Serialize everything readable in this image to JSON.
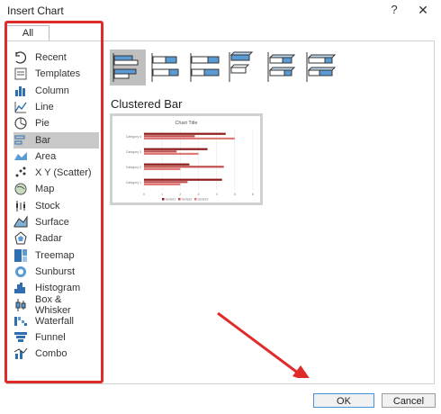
{
  "window": {
    "title": "Insert Chart",
    "help_label": "?",
    "close_label": "✕"
  },
  "tabs": [
    {
      "label": "All Charts"
    }
  ],
  "categories": [
    {
      "label": "Recent",
      "icon": "recent-icon"
    },
    {
      "label": "Templates",
      "icon": "templates-icon"
    },
    {
      "label": "Column",
      "icon": "column-chart-icon"
    },
    {
      "label": "Line",
      "icon": "line-chart-icon"
    },
    {
      "label": "Pie",
      "icon": "pie-chart-icon"
    },
    {
      "label": "Bar",
      "icon": "bar-chart-icon",
      "selected": true
    },
    {
      "label": "Area",
      "icon": "area-chart-icon"
    },
    {
      "label": "X Y (Scatter)",
      "icon": "scatter-chart-icon"
    },
    {
      "label": "Map",
      "icon": "map-chart-icon"
    },
    {
      "label": "Stock",
      "icon": "stock-chart-icon"
    },
    {
      "label": "Surface",
      "icon": "surface-chart-icon"
    },
    {
      "label": "Radar",
      "icon": "radar-chart-icon"
    },
    {
      "label": "Treemap",
      "icon": "treemap-chart-icon"
    },
    {
      "label": "Sunburst",
      "icon": "sunburst-chart-icon"
    },
    {
      "label": "Histogram",
      "icon": "histogram-chart-icon"
    },
    {
      "label": "Box & Whisker",
      "icon": "box-whisker-chart-icon"
    },
    {
      "label": "Waterfall",
      "icon": "waterfall-chart-icon"
    },
    {
      "label": "Funnel",
      "icon": "funnel-chart-icon"
    },
    {
      "label": "Combo",
      "icon": "combo-chart-icon"
    }
  ],
  "subtypes": [
    {
      "icon": "clustered-bar-icon",
      "active": true
    },
    {
      "icon": "stacked-bar-icon"
    },
    {
      "icon": "100-stacked-bar-icon"
    },
    {
      "icon": "3d-clustered-bar-icon"
    },
    {
      "icon": "3d-stacked-bar-icon"
    },
    {
      "icon": "3d-100-stacked-bar-icon"
    }
  ],
  "preview": {
    "heading": "Clustered Bar",
    "chart_data": {
      "type": "bar",
      "title": "Chart Title",
      "categories": [
        "Category 1",
        "Category 2",
        "Category 3",
        "Category 4"
      ],
      "series": [
        {
          "name": "Series1",
          "color": "#8b1a1a",
          "values": [
            4.3,
            2.5,
            3.5,
            4.5
          ]
        },
        {
          "name": "Series2",
          "color": "#c0504d",
          "values": [
            2.4,
            4.4,
            1.8,
            2.8
          ]
        },
        {
          "name": "Series3",
          "color": "#e07a78",
          "values": [
            2,
            2,
            3,
            5
          ]
        }
      ],
      "xticks": [
        "0",
        "1",
        "2",
        "3",
        "4",
        "5",
        "6"
      ],
      "xlim": [
        0,
        6
      ]
    }
  },
  "buttons": {
    "ok_label": "OK",
    "cancel_label": "Cancel"
  },
  "colors": {
    "highlight": "#e02b2b",
    "selected_bg": "#c8c8c8",
    "accent": "#4a8fd9"
  }
}
